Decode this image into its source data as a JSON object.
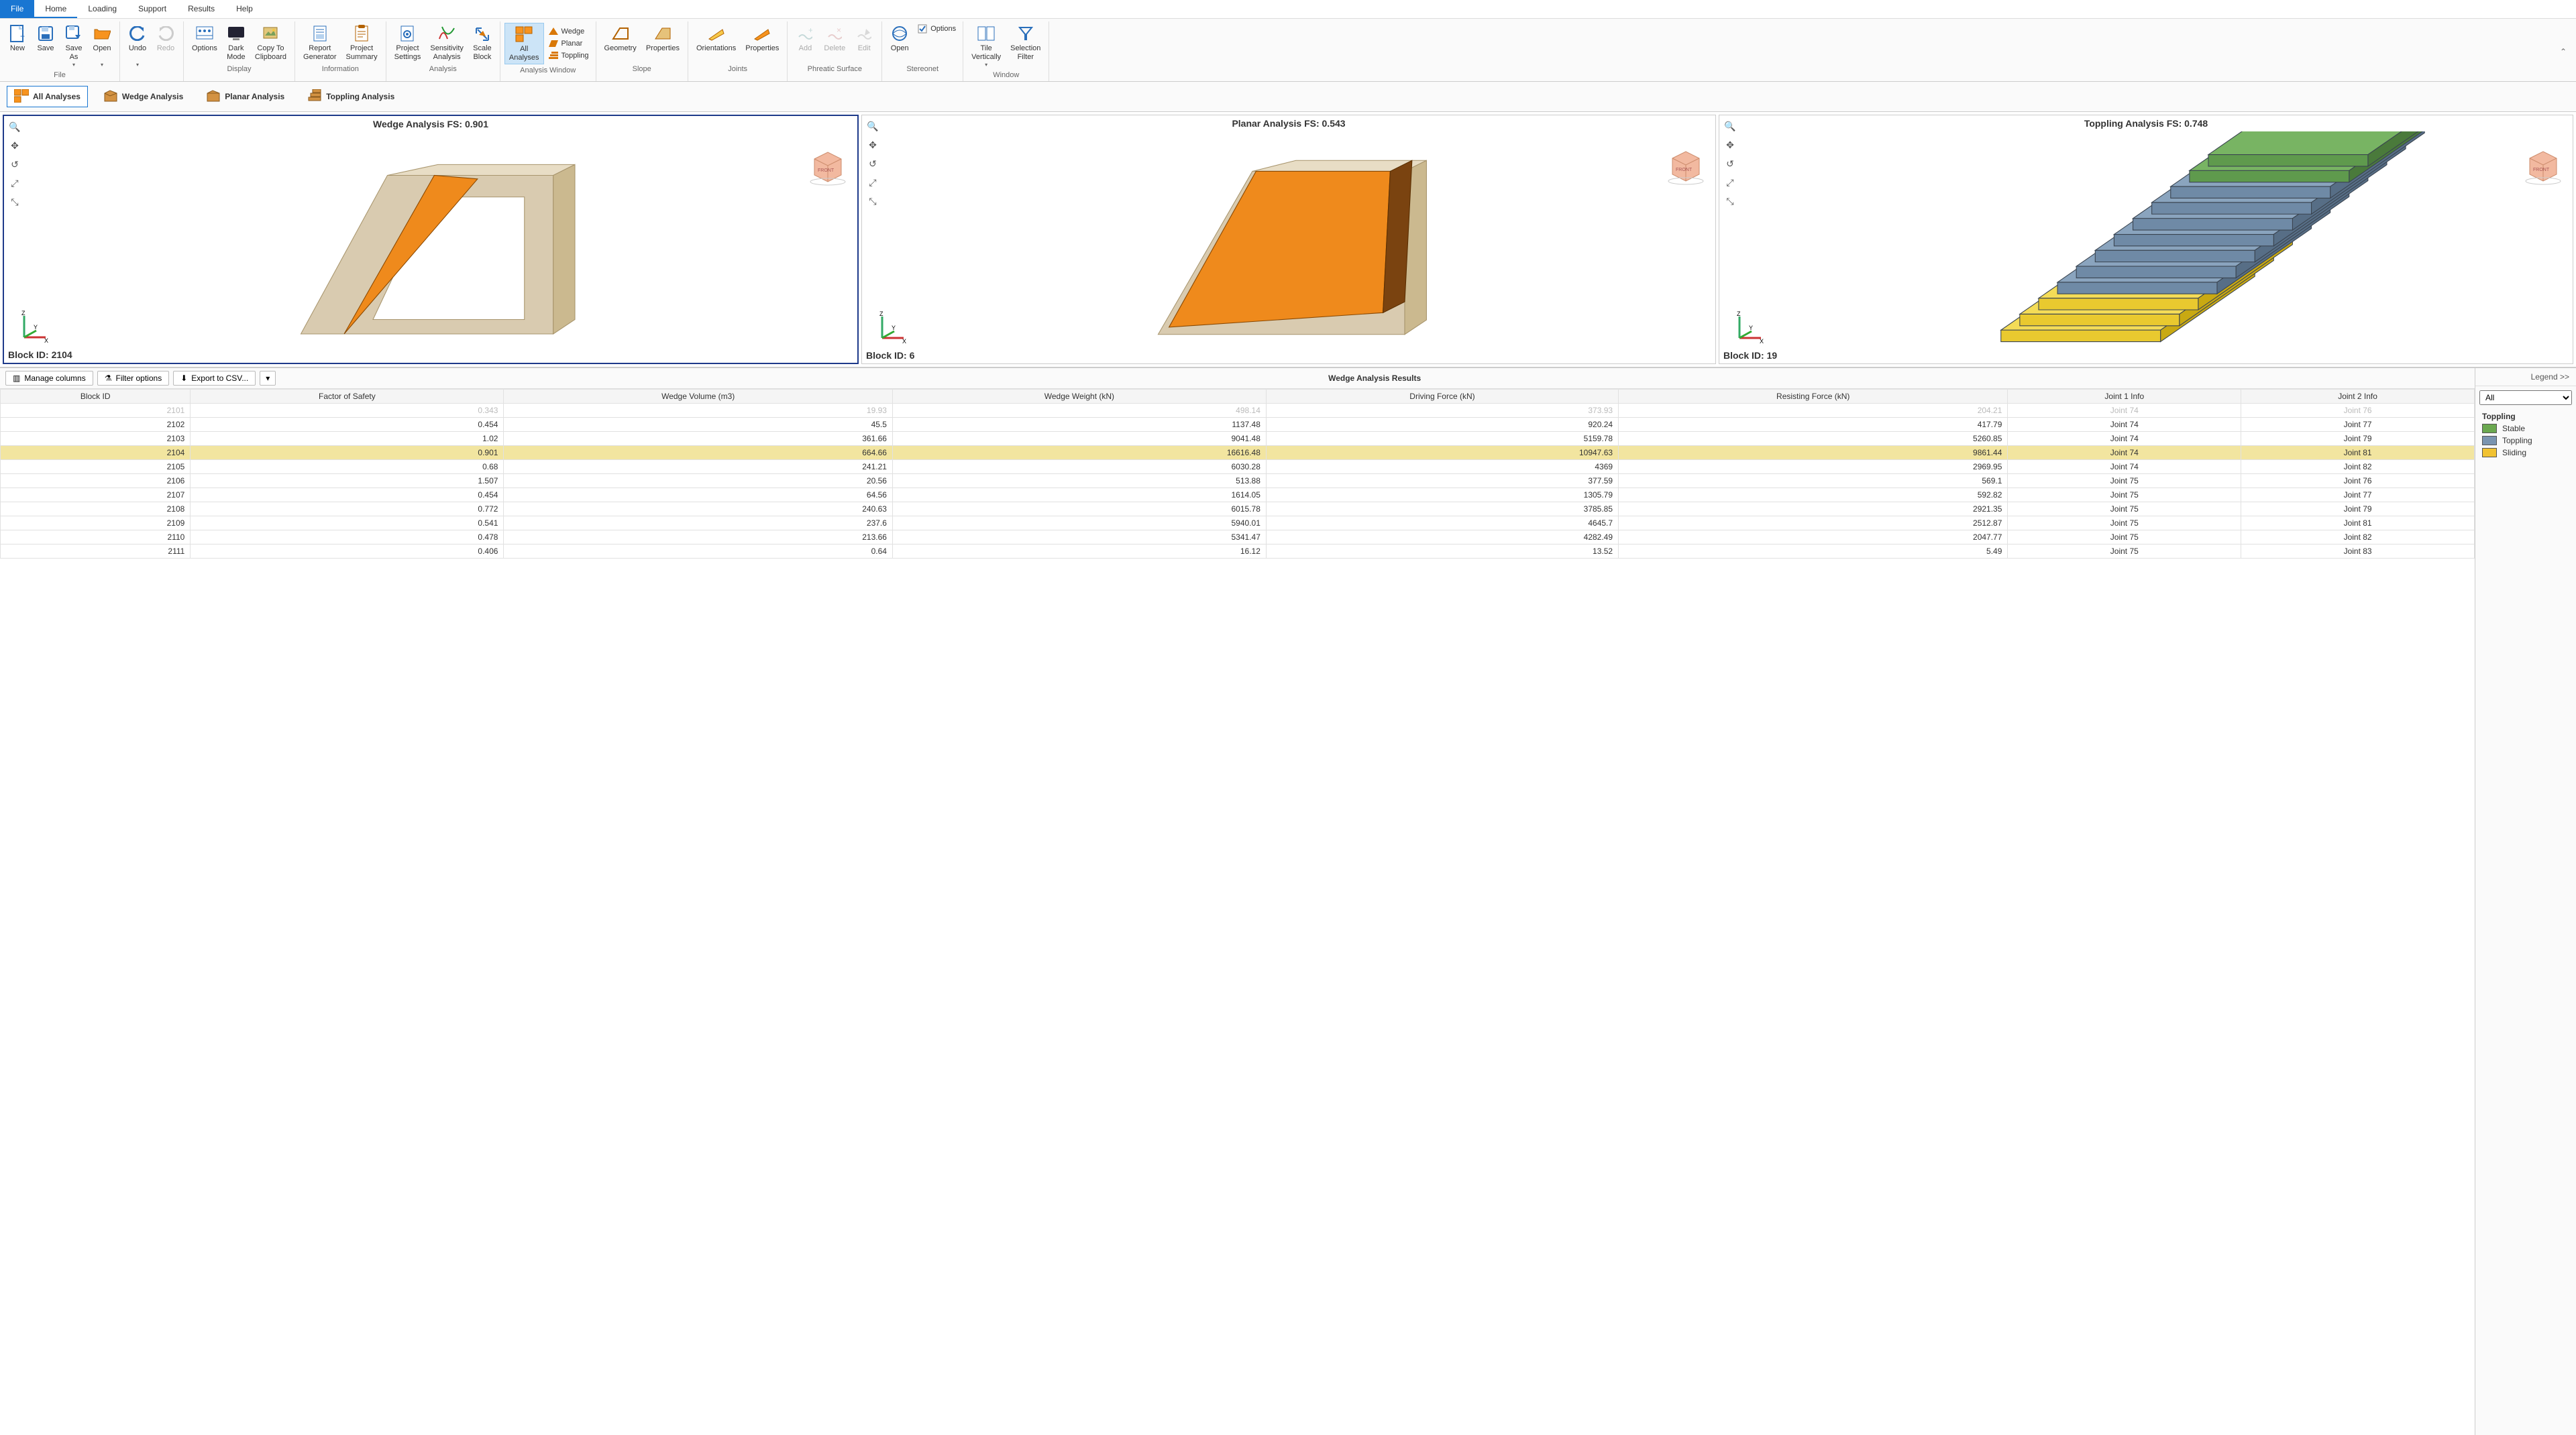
{
  "menu": {
    "file": "File",
    "home": "Home",
    "loading": "Loading",
    "support": "Support",
    "results": "Results",
    "help": "Help"
  },
  "ribbon": {
    "file": {
      "new": "New",
      "save": "Save",
      "saveAs": "Save\nAs",
      "open": "Open",
      "label": "File"
    },
    "undo": "Undo",
    "redo": "Redo",
    "display": {
      "options": "Options",
      "dark": "Dark\nMode",
      "copy": "Copy To\nClipboard",
      "label": "Display"
    },
    "info": {
      "report": "Report\nGenerator",
      "summary": "Project\nSummary",
      "label": "Information"
    },
    "analysis": {
      "settings": "Project\nSettings",
      "sensitivity": "Sensitivity\nAnalysis",
      "scale": "Scale\nBlock",
      "label": "Analysis"
    },
    "anawin": {
      "all": "All\nAnalyses",
      "wedge": "Wedge",
      "planar": "Planar",
      "toppling": "Toppling",
      "label": "Analysis Window"
    },
    "slope": {
      "geometry": "Geometry",
      "properties": "Properties",
      "label": "Slope"
    },
    "joints": {
      "orientations": "Orientations",
      "properties": "Properties",
      "label": "Joints"
    },
    "phreatic": {
      "add": "Add",
      "delete": "Delete",
      "edit": "Edit",
      "label": "Phreatic Surface"
    },
    "stereonet": {
      "open": "Open",
      "options": "Options",
      "label": "Stereonet"
    },
    "window": {
      "tile": "Tile\nVertically",
      "filter": "Selection\nFilter",
      "label": "Window"
    }
  },
  "analysisTabs": {
    "all": "All Analyses",
    "wedge": "Wedge Analysis",
    "planar": "Planar Analysis",
    "toppling": "Toppling Analysis"
  },
  "viewports": {
    "wedge": {
      "title": "Wedge Analysis FS: 0.901",
      "blockId": "Block ID: 2104"
    },
    "planar": {
      "title": "Planar Analysis FS: 0.543",
      "blockId": "Block ID: 6"
    },
    "toppling": {
      "title": "Toppling Analysis FS: 0.748",
      "blockId": "Block ID: 19"
    }
  },
  "resultsToolbar": {
    "manage": "Manage columns",
    "filter": "Filter options",
    "export": "Export to CSV..."
  },
  "resultsTitle": "Wedge Analysis Results",
  "columns": [
    "Block ID",
    "Factor of Safety",
    "Wedge Volume (m3)",
    "Wedge Weight (kN)",
    "Driving Force (kN)",
    "Resisting Force (kN)",
    "Joint 1 Info",
    "Joint 2 Info"
  ],
  "rows": [
    {
      "truncated": true,
      "cells": [
        "2101",
        "0.343",
        "19.93",
        "498.14",
        "373.93",
        "204.21",
        "Joint 74",
        "Joint 76"
      ]
    },
    {
      "cells": [
        "2102",
        "0.454",
        "45.5",
        "1137.48",
        "920.24",
        "417.79",
        "Joint 74",
        "Joint 77"
      ]
    },
    {
      "cells": [
        "2103",
        "1.02",
        "361.66",
        "9041.48",
        "5159.78",
        "5260.85",
        "Joint 74",
        "Joint 79"
      ]
    },
    {
      "highlight": true,
      "cells": [
        "2104",
        "0.901",
        "664.66",
        "16616.48",
        "10947.63",
        "9861.44",
        "Joint 74",
        "Joint 81"
      ]
    },
    {
      "cells": [
        "2105",
        "0.68",
        "241.21",
        "6030.28",
        "4369",
        "2969.95",
        "Joint 74",
        "Joint 82"
      ]
    },
    {
      "cells": [
        "2106",
        "1.507",
        "20.56",
        "513.88",
        "377.59",
        "569.1",
        "Joint 75",
        "Joint 76"
      ]
    },
    {
      "cells": [
        "2107",
        "0.454",
        "64.56",
        "1614.05",
        "1305.79",
        "592.82",
        "Joint 75",
        "Joint 77"
      ]
    },
    {
      "cells": [
        "2108",
        "0.772",
        "240.63",
        "6015.78",
        "3785.85",
        "2921.35",
        "Joint 75",
        "Joint 79"
      ]
    },
    {
      "cells": [
        "2109",
        "0.541",
        "237.6",
        "5940.01",
        "4645.7",
        "2512.87",
        "Joint 75",
        "Joint 81"
      ]
    },
    {
      "cells": [
        "2110",
        "0.478",
        "213.66",
        "5341.47",
        "4282.49",
        "2047.77",
        "Joint 75",
        "Joint 82"
      ]
    },
    {
      "cells": [
        "2111",
        "0.406",
        "0.64",
        "16.12",
        "13.52",
        "5.49",
        "Joint 75",
        "Joint 83"
      ]
    }
  ],
  "legend": {
    "header": "Legend >>",
    "selectValue": "All",
    "section": "Toppling",
    "items": [
      {
        "label": "Stable",
        "color": "#6aa84f"
      },
      {
        "label": "Toppling",
        "color": "#7a94b0"
      },
      {
        "label": "Sliding",
        "color": "#f1c232"
      }
    ]
  }
}
